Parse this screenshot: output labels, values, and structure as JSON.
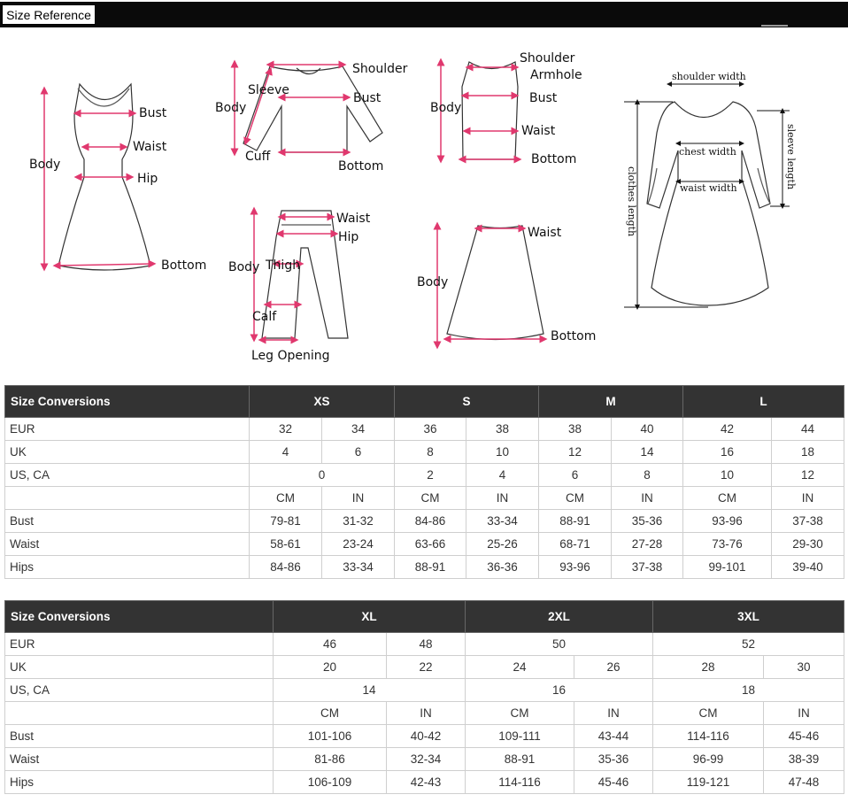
{
  "header": {
    "tab_label": "Size Reference"
  },
  "diagram_labels": {
    "dress": {
      "bust": "Bust",
      "waist": "Waist",
      "hip": "Hip",
      "body": "Body",
      "bottom": "Bottom"
    },
    "top": {
      "shoulder": "Shoulder",
      "sleeve": "Sleeve",
      "bust": "Bust",
      "body": "Body",
      "cuff": "Cuff",
      "bottom": "Bottom"
    },
    "vest": {
      "shoulder": "Shoulder",
      "armhole": "Armhole",
      "bust": "Bust",
      "body": "Body",
      "waist": "Waist",
      "bottom": "Bottom"
    },
    "pants": {
      "waist": "Waist",
      "hip": "Hip",
      "body": "Body",
      "thigh": "Thigh",
      "calf": "Calf",
      "leg_opening": "Leg Opening"
    },
    "skirt": {
      "waist": "Waist",
      "body": "Body",
      "bottom": "Bottom"
    },
    "long_dress": {
      "shoulder_width": "shoulder width",
      "chest_width": "chest width",
      "waist_width": "waist width",
      "clothes_length": "clothes length",
      "sleeve_length": "sleeve length"
    }
  },
  "table1": {
    "title": "Size Conversions",
    "sizes": [
      "XS",
      "S",
      "M",
      "L"
    ],
    "eur": [
      "32",
      "34",
      "36",
      "38",
      "38",
      "40",
      "42",
      "44"
    ],
    "uk": [
      "4",
      "6",
      "8",
      "10",
      "12",
      "14",
      "16",
      "18"
    ],
    "us_ca": [
      "0",
      "2",
      "4",
      "6",
      "8",
      "10",
      "12"
    ],
    "units": [
      "CM",
      "IN",
      "CM",
      "IN",
      "CM",
      "IN",
      "CM",
      "IN"
    ],
    "row_labels": {
      "eur": "EUR",
      "uk": "UK",
      "us_ca": "US, CA",
      "bust": "Bust",
      "waist": "Waist",
      "hips": "Hips"
    },
    "bust": [
      "79-81",
      "31-32",
      "84-86",
      "33-34",
      "88-91",
      "35-36",
      "93-96",
      "37-38"
    ],
    "waist": [
      "58-61",
      "23-24",
      "63-66",
      "25-26",
      "68-71",
      "27-28",
      "73-76",
      "29-30"
    ],
    "hips": [
      "84-86",
      "33-34",
      "88-91",
      "36-36",
      "93-96",
      "37-38",
      "99-101",
      "39-40"
    ]
  },
  "table2": {
    "title": "Size Conversions",
    "sizes": [
      "XL",
      "2XL",
      "3XL"
    ],
    "eur": [
      "46",
      "48",
      "50",
      "52"
    ],
    "uk": [
      "20",
      "22",
      "24",
      "26",
      "28",
      "30"
    ],
    "us_ca": [
      "14",
      "16",
      "18"
    ],
    "units": [
      "CM",
      "IN",
      "CM",
      "IN",
      "CM",
      "IN"
    ],
    "row_labels": {
      "eur": "EUR",
      "uk": "UK",
      "us_ca": "US, CA",
      "bust": "Bust",
      "waist": "Waist",
      "hips": "Hips"
    },
    "bust": [
      "101-106",
      "40-42",
      "109-111",
      "43-44",
      "114-116",
      "45-46"
    ],
    "waist": [
      "81-86",
      "32-34",
      "88-91",
      "35-36",
      "96-99",
      "38-39"
    ],
    "hips": [
      "106-109",
      "42-43",
      "114-116",
      "45-46",
      "119-121",
      "47-48"
    ]
  }
}
